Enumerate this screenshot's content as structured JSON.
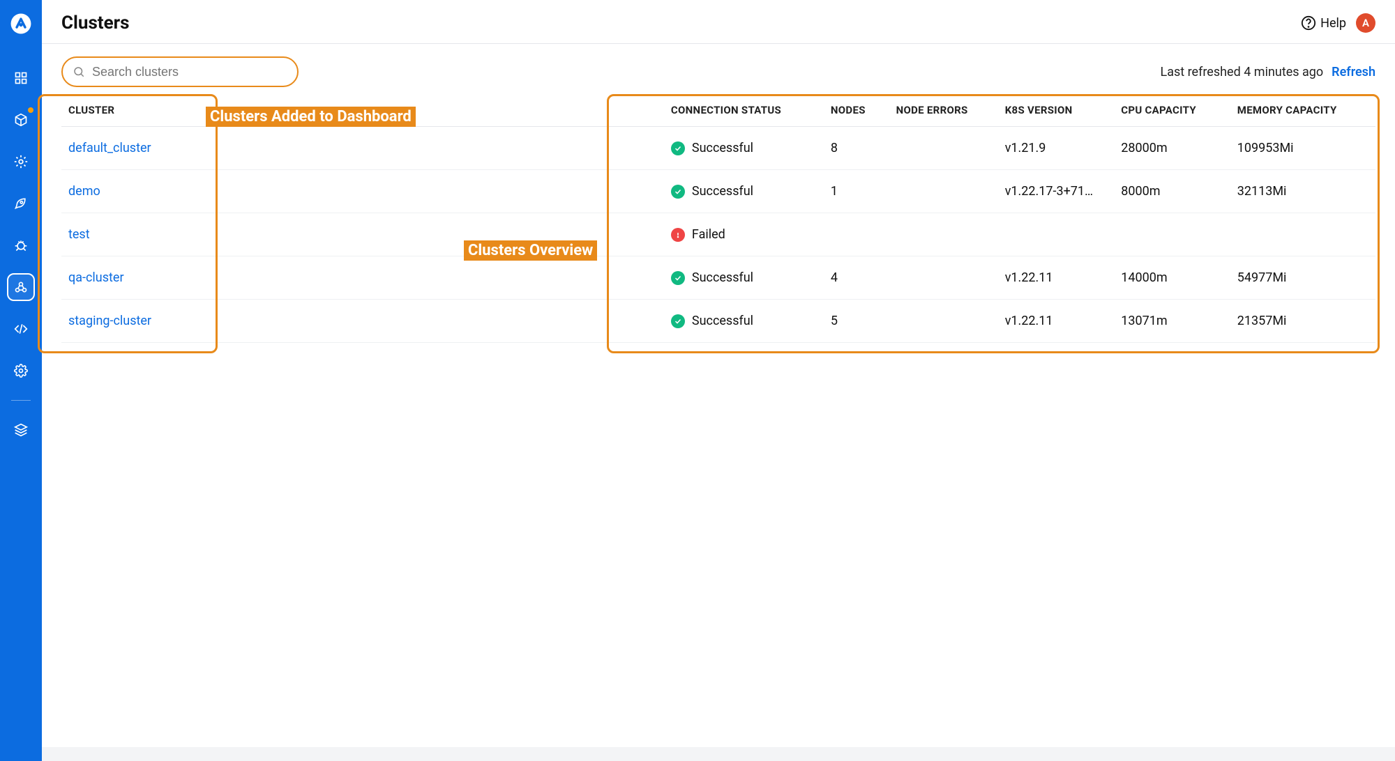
{
  "header": {
    "title": "Clusters",
    "help_label": "Help",
    "avatar_letter": "A"
  },
  "search": {
    "placeholder": "Search clusters"
  },
  "refresh": {
    "text": "Last refreshed 4 minutes ago",
    "link": "Refresh"
  },
  "annotations": {
    "left": "Clusters Added to Dashboard",
    "right": "Clusters Overview"
  },
  "table": {
    "headers": {
      "cluster": "CLUSTER",
      "connection_status": "CONNECTION STATUS",
      "nodes": "NODES",
      "node_errors": "NODE ERRORS",
      "k8s_version": "K8S VERSION",
      "cpu_capacity": "CPU CAPACITY",
      "memory_capacity": "MEMORY CAPACITY"
    },
    "rows": [
      {
        "cluster": "default_cluster",
        "status": "Successful",
        "status_kind": "success",
        "nodes": "8",
        "node_errors": "",
        "k8s": "v1.21.9",
        "cpu": "28000m",
        "mem": "109953Mi"
      },
      {
        "cluster": "demo",
        "status": "Successful",
        "status_kind": "success",
        "nodes": "1",
        "node_errors": "",
        "k8s": "v1.22.17-3+71…",
        "cpu": "8000m",
        "mem": "32113Mi"
      },
      {
        "cluster": "test",
        "status": "Failed",
        "status_kind": "failed",
        "nodes": "",
        "node_errors": "",
        "k8s": "",
        "cpu": "",
        "mem": ""
      },
      {
        "cluster": "qa-cluster",
        "status": "Successful",
        "status_kind": "success",
        "nodes": "4",
        "node_errors": "",
        "k8s": "v1.22.11",
        "cpu": "14000m",
        "mem": "54977Mi"
      },
      {
        "cluster": "staging-cluster",
        "status": "Successful",
        "status_kind": "success",
        "nodes": "5",
        "node_errors": "",
        "k8s": "v1.22.11",
        "cpu": "13071m",
        "mem": "21357Mi"
      }
    ]
  }
}
